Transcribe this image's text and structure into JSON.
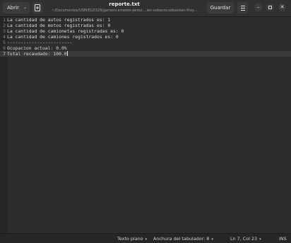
{
  "header": {
    "open_label": "Abrir",
    "title": "reporte.txt",
    "path": "~/Documentos/USM/ELO329/gamero.ernesto-perez....ien-sobarzo.sebastian-Proy...",
    "save_label": "Guardar"
  },
  "editor": {
    "lines": [
      {
        "num": "1",
        "text": "La cantidad de autos registrados es: 1"
      },
      {
        "num": "2",
        "text": "La cantidad de motos registradas es: 0"
      },
      {
        "num": "3",
        "text": "La cantidad de camionetas registradas es: 0"
      },
      {
        "num": "4",
        "text": "La cantidad de camiones registrados es: 0"
      },
      {
        "num": "5",
        "text": "------------------------"
      },
      {
        "num": "6",
        "text": "Ocupacion actual: 0.0%"
      },
      {
        "num": "7",
        "text": "Total recaudado: 100.0"
      }
    ]
  },
  "statusbar": {
    "language": "Texto plano",
    "tab_width": "Anchura del tabulador: 8",
    "position": "Ln 7, Col 23",
    "insert_mode": "INS"
  },
  "icons": {
    "open_dropdown": "chevron-down-icon",
    "new_tab": "new-tab-icon",
    "menu": "hamburger-menu-icon",
    "minimize": "minimize-icon",
    "maximize": "maximize-icon",
    "close": "close-icon"
  },
  "colors": {
    "header_bg": "#303030",
    "editor_bg": "#2d2d2d",
    "current_line_bg": "#3a3a3a",
    "text": "#d8d8d8"
  }
}
